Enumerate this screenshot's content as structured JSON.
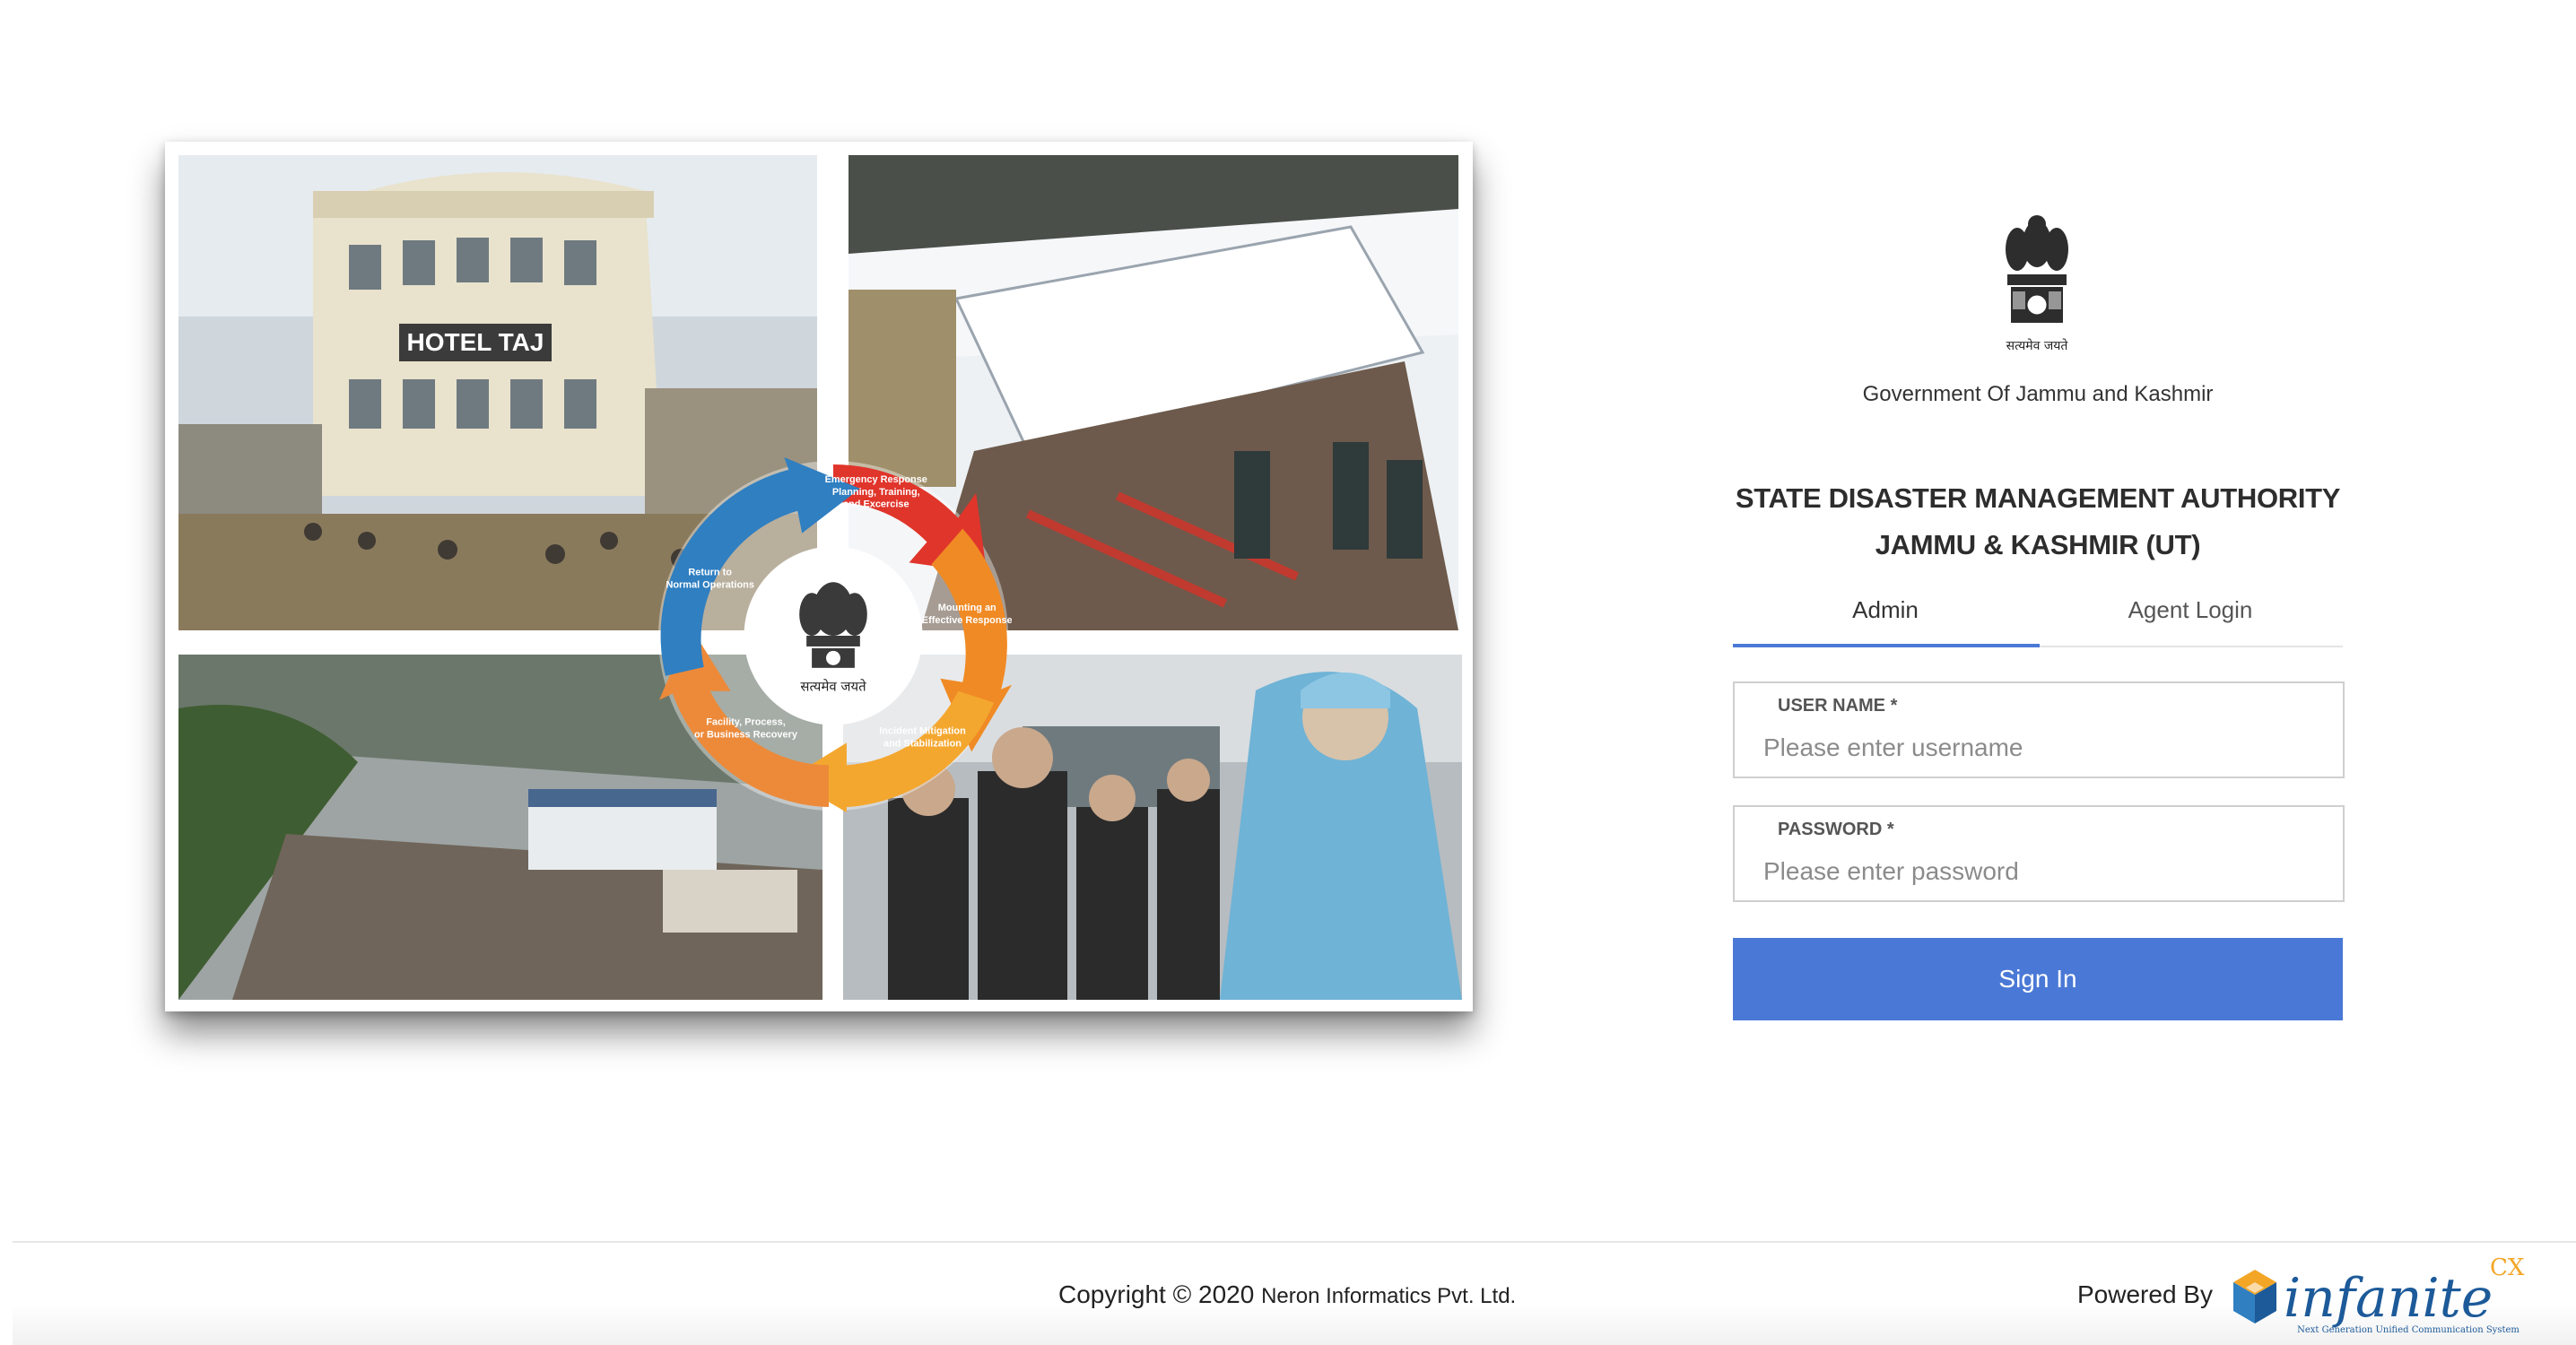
{
  "collage": {
    "hotel_sign": "HOTEL TAJ",
    "cycle": {
      "emblem_caption": "सत्यमेव जयते",
      "segments": [
        {
          "line1": "Emergency Response",
          "line2": "Planning, Training,",
          "line3": "and Excercise",
          "color": "#e0352b"
        },
        {
          "line1": "Mounting an",
          "line2": "Effective Response",
          "line3": "",
          "color": "#f08a24"
        },
        {
          "line1": "Incident Mitigation",
          "line2": "and Stabilization",
          "line3": "",
          "color": "#f4a72f"
        },
        {
          "line1": "Facility, Process,",
          "line2": "or Business Recovery",
          "line3": "",
          "color": "#ec8a3a"
        },
        {
          "line1": "Return to",
          "line2": "Normal Operations",
          "line3": "",
          "color": "#2f7fc1"
        }
      ]
    }
  },
  "login": {
    "emblem_caption": "सत्यमेव जयते",
    "government": "Government Of Jammu and Kashmir",
    "authority_line1": "STATE DISASTER MANAGEMENT AUTHORITY",
    "authority_line2": "JAMMU & KASHMIR (UT)",
    "tabs": [
      {
        "label": "Admin",
        "active": true
      },
      {
        "label": "Agent Login",
        "active": false
      }
    ],
    "username": {
      "label": "USER NAME *",
      "placeholder": "Please enter username",
      "value": ""
    },
    "password": {
      "label": "PASSWORD *",
      "placeholder": "Please enter password",
      "value": ""
    },
    "signin_label": "Sign In",
    "accent_color": "#4a78d6"
  },
  "footer": {
    "copyright": "Copyright © 2020",
    "company": "Neron Informatics Pvt. Ltd.",
    "powered_by": "Powered By",
    "logo_text": "infanite",
    "logo_superscript": "CX",
    "logo_tagline": "Next Generation Unified Communication System"
  }
}
